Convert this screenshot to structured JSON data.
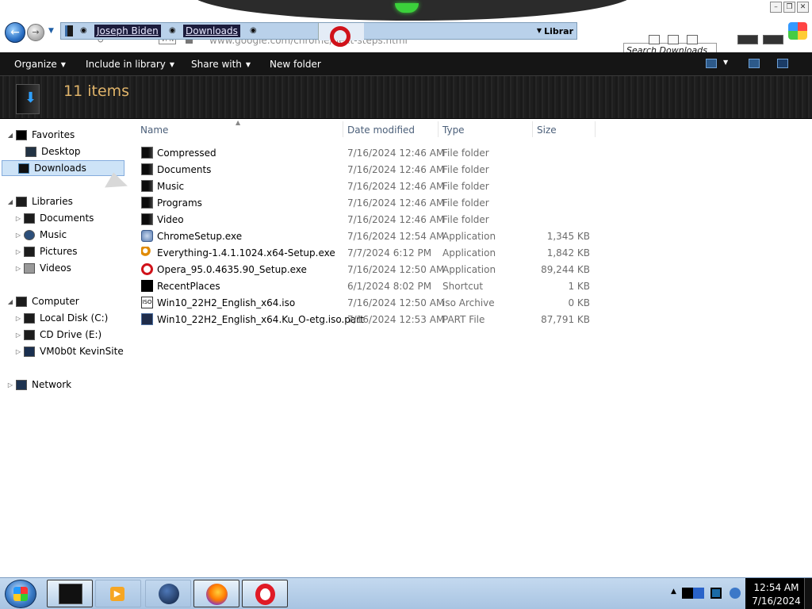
{
  "window": {
    "controls": [
      "minimize",
      "restore",
      "close"
    ]
  },
  "nav": {
    "back_icon": "back-arrow-icon",
    "forward_icon": "forward-arrow-icon",
    "breadcrumbs": [
      "Joseph Biden",
      "Downloads"
    ],
    "address_right_text": "Librar",
    "background_url": "www.google.com/chrome/next-steps.html",
    "background_vpn": "VPN",
    "search_placeholder": "Search Downloads"
  },
  "toolbar": {
    "organize": "Organize",
    "include_in_library": "Include in library",
    "share_with": "Share with",
    "new_folder": "New folder"
  },
  "header": {
    "item_count": "11 items",
    "item_count_color": "#e0b46a"
  },
  "navpane": {
    "favorites": "Favorites",
    "desktop": "Desktop",
    "downloads": "Downloads",
    "libraries": "Libraries",
    "documents": "Documents",
    "music": "Music",
    "pictures": "Pictures",
    "videos": "Videos",
    "computer": "Computer",
    "local_disk": "Local Disk (C:)",
    "cd_drive": "CD Drive (E:)",
    "vm_share": "VM0b0t KevinSite",
    "network": "Network"
  },
  "columns": {
    "name": "Name",
    "date_modified": "Date modified",
    "type": "Type",
    "size": "Size"
  },
  "files": [
    {
      "name": "Compressed",
      "date": "7/16/2024 12:46 AM",
      "type": "File folder",
      "size": "",
      "icon": "folder-icon"
    },
    {
      "name": "Documents",
      "date": "7/16/2024 12:46 AM",
      "type": "File folder",
      "size": "",
      "icon": "folder-icon"
    },
    {
      "name": "Music",
      "date": "7/16/2024 12:46 AM",
      "type": "File folder",
      "size": "",
      "icon": "folder-icon"
    },
    {
      "name": "Programs",
      "date": "7/16/2024 12:46 AM",
      "type": "File folder",
      "size": "",
      "icon": "folder-icon"
    },
    {
      "name": "Video",
      "date": "7/16/2024 12:46 AM",
      "type": "File folder",
      "size": "",
      "icon": "folder-icon"
    },
    {
      "name": "ChromeSetup.exe",
      "date": "7/16/2024 12:54 AM",
      "type": "Application",
      "size": "1,345 KB",
      "icon": "installer-icon"
    },
    {
      "name": "Everything-1.4.1.1024.x64-Setup.exe",
      "date": "7/7/2024 6:12 PM",
      "type": "Application",
      "size": "1,842 KB",
      "icon": "magnifier-icon"
    },
    {
      "name": "Opera_95.0.4635.90_Setup.exe",
      "date": "7/16/2024 12:50 AM",
      "type": "Application",
      "size": "89,244 KB",
      "icon": "opera-icon"
    },
    {
      "name": "RecentPlaces",
      "date": "6/1/2024 8:02 PM",
      "type": "Shortcut",
      "size": "1 KB",
      "icon": "shortcut-icon"
    },
    {
      "name": "Win10_22H2_English_x64.iso",
      "date": "7/16/2024 12:50 AM",
      "type": "iso Archive",
      "size": "0 KB",
      "icon": "iso-icon"
    },
    {
      "name": "Win10_22H2_English_x64.Ku_O-etg.iso.part",
      "date": "7/16/2024 12:53 AM",
      "type": "PART File",
      "size": "87,791 KB",
      "icon": "part-file-icon"
    }
  ],
  "taskbar": {
    "clock_time": "12:54 AM",
    "clock_date": "7/16/2024",
    "pinned": [
      "explorer-icon",
      "media-player-icon",
      "globe-icon",
      "firefox-icon",
      "opera-icon"
    ]
  }
}
